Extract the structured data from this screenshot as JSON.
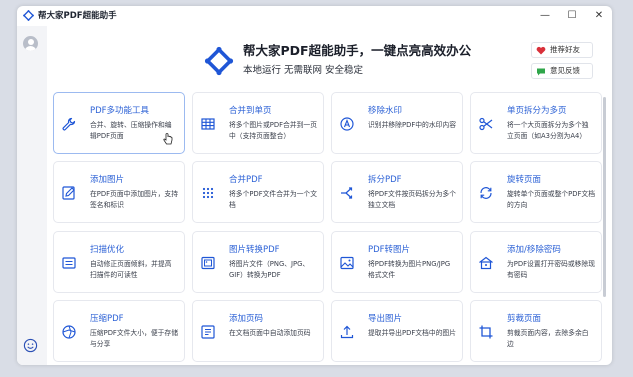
{
  "window": {
    "title": "帮大家PDF超能助手",
    "minimize": "—",
    "maximize": "☐",
    "close": "✕"
  },
  "hero": {
    "title": "帮大家PDF超能助手，一键点亮高效办公",
    "subtitle": "本地运行 无需联网 安全稳定"
  },
  "actions": {
    "recommend": "推荐好友",
    "feedback": "意见反馈"
  },
  "colors": {
    "accent": "#1f56d6",
    "heart": "#d9303a",
    "feedback": "#2fa64a"
  },
  "tools": [
    {
      "name": "PDF多功能工具",
      "desc": "合并、旋转、压缩操作和编辑PDF页面",
      "icon": "wrench-icon",
      "active": true
    },
    {
      "name": "合并到单页",
      "desc": "将多个图片或PDF合并到一页中（支持页面整合）",
      "icon": "grid-icon"
    },
    {
      "name": "移除水印",
      "desc": "识别并移除PDF中的水印内容",
      "icon": "watermark-icon"
    },
    {
      "name": "单页拆分为多页",
      "desc": "将一个大页面拆分为多个独立页面（如A3分割为A4）",
      "icon": "scissors-icon"
    },
    {
      "name": "添加图片",
      "desc": "在PDF页面中添加图片，支持签名和标识",
      "icon": "pen-icon"
    },
    {
      "name": "合并PDF",
      "desc": "将多个PDF文件合并为一个文档",
      "icon": "merge-icon"
    },
    {
      "name": "拆分PDF",
      "desc": "将PDF文件按页码拆分为多个独立文档",
      "icon": "split-icon"
    },
    {
      "name": "旋转页面",
      "desc": "旋转单个页面或整个PDF文档的方向",
      "icon": "rotate-icon"
    },
    {
      "name": "扫描优化",
      "desc": "自动修正页面倾斜，并提高扫描件的可读性",
      "icon": "scan-icon"
    },
    {
      "name": "图片转换PDF",
      "desc": "将图片文件（PNG、JPG、GIF）转换为PDF",
      "icon": "image-to-pdf-icon"
    },
    {
      "name": "PDF转图片",
      "desc": "将PDF转换为图片PNG/JPG格式文件",
      "icon": "pdf-to-image-icon"
    },
    {
      "name": "添加/移除密码",
      "desc": "为PDF设置打开密码或移除现有密码",
      "icon": "lock-icon"
    },
    {
      "name": "压缩PDF",
      "desc": "压缩PDF文件大小，便于存储与分享",
      "icon": "compress-icon"
    },
    {
      "name": "添加页码",
      "desc": "在文档页面中自动添加页码",
      "icon": "page-number-icon"
    },
    {
      "name": "导出图片",
      "desc": "提取并导出PDF文档中的图片",
      "icon": "export-icon"
    },
    {
      "name": "剪裁页面",
      "desc": "剪裁页面内容，去除多余白边",
      "icon": "crop-icon"
    }
  ]
}
